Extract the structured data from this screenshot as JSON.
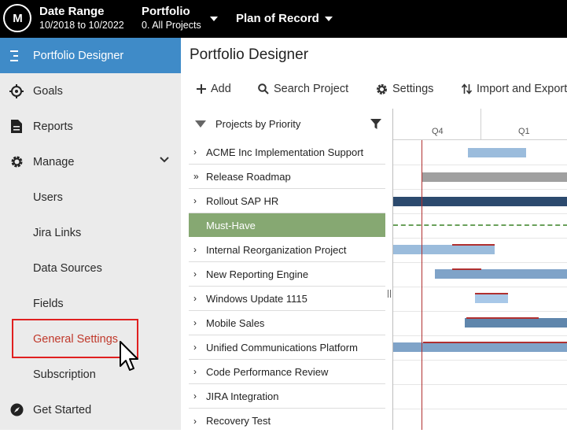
{
  "topbar": {
    "logo_text": "M",
    "date_range_title": "Date Range",
    "date_range_value": "10/2018 to 10/2022",
    "portfolio_title": "Portfolio",
    "portfolio_value": "0. All Projects",
    "plan_label": "Plan of Record"
  },
  "sidebar": {
    "active": "Portfolio Designer",
    "goals": "Goals",
    "reports": "Reports",
    "manage": "Manage",
    "users": "Users",
    "jira_links": "Jira Links",
    "data_sources": "Data Sources",
    "fields": "Fields",
    "general_settings": "General Settings",
    "subscription": "Subscription",
    "get_started": "Get Started"
  },
  "main": {
    "title": "Portfolio Designer",
    "toolbar": {
      "add": "Add",
      "search": "Search Project",
      "settings": "Settings",
      "import": "Import and Export"
    },
    "list_header": "Projects by Priority",
    "rows": [
      "ACME Inc Implementation Support",
      "Release Roadmap",
      "Rollout SAP HR",
      "Must-Have",
      "Internal Reorganization Project",
      "New Reporting Engine",
      "Windows Update 1115",
      "Mobile Sales",
      "Unified Communications Platform",
      "Code Performance Review",
      "JIRA Integration",
      "Recovery Test"
    ],
    "timeline": {
      "q4": "Q4",
      "q1": "Q1"
    }
  },
  "colors": {
    "topbar": "#000000",
    "sidebar": "#ebebeb",
    "active": "#3f8bc8",
    "group_row": "#86a872",
    "highlight": "#e02020",
    "today_line": "#b03030"
  }
}
